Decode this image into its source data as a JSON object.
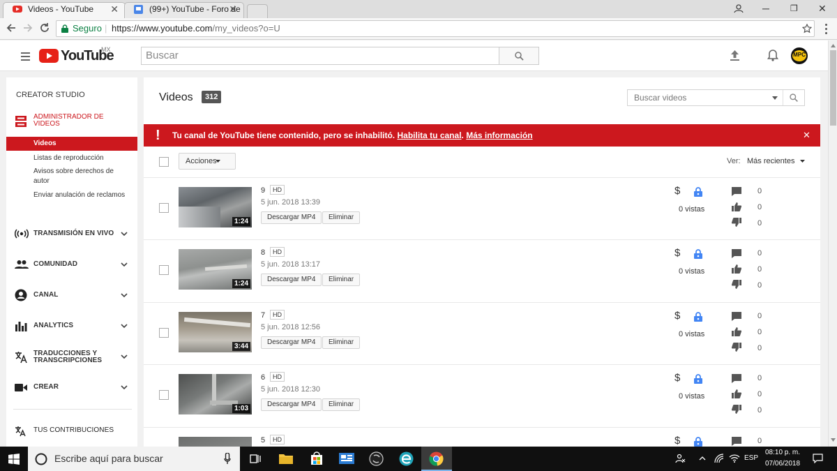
{
  "browser": {
    "tabs": [
      {
        "title": "Videos - YouTube"
      },
      {
        "title": "(99+) YouTube - Foro de"
      }
    ],
    "secure_label": "Seguro",
    "url_host": "https://www.youtube.com",
    "url_path": "/my_videos?o=U"
  },
  "masthead": {
    "logo_text": "YouTube",
    "region": "MX",
    "search_placeholder": "Buscar",
    "avatar_text": "MPC"
  },
  "sidebar": {
    "header": "CREATOR STUDIO",
    "manager_label": "ADMINISTRADOR DE VIDEOS",
    "sub_items": [
      {
        "label": "Videos"
      },
      {
        "label": "Listas de reproducción"
      },
      {
        "label": "Avisos sobre derechos de autor"
      },
      {
        "label": "Enviar anulación de reclamos"
      }
    ],
    "sections": [
      {
        "label": "TRANSMISIÓN EN VIVO"
      },
      {
        "label": "COMUNIDAD"
      },
      {
        "label": "CANAL"
      },
      {
        "label": "ANALYTICS"
      },
      {
        "label": "TRADUCCIONES Y TRANSCRIPCIONES"
      },
      {
        "label": "CREAR"
      }
    ],
    "contrib_label": "TUS CONTRIBUCIONES"
  },
  "main": {
    "title": "Videos",
    "count": "312",
    "search_placeholder": "Buscar videos",
    "banner_text": "Tu canal de YouTube tiene contenido, pero se inhabilitó.",
    "banner_link1": "Habilita tu canal",
    "banner_sep": ".",
    "banner_link2": "Más información",
    "actions_label": "Acciones",
    "view_label": "Ver:",
    "sort_label": "Más recientes",
    "download_label": "Descargar MP4",
    "delete_label": "Eliminar",
    "videos": [
      {
        "title": "9",
        "quality": "HD",
        "date": "5 jun. 2018 13:39",
        "duration": "1:24",
        "views": "0 vistas",
        "comments": "0",
        "likes": "0",
        "dislikes": "0"
      },
      {
        "title": "8",
        "quality": "HD",
        "date": "5 jun. 2018 13:17",
        "duration": "1:24",
        "views": "0 vistas",
        "comments": "0",
        "likes": "0",
        "dislikes": "0"
      },
      {
        "title": "7",
        "quality": "HD",
        "date": "5 jun. 2018 12:56",
        "duration": "3:44",
        "views": "0 vistas",
        "comments": "0",
        "likes": "0",
        "dislikes": "0"
      },
      {
        "title": "6",
        "quality": "HD",
        "date": "5 jun. 2018 12:30",
        "duration": "1:03",
        "views": "0 vistas",
        "comments": "0",
        "likes": "0",
        "dislikes": "0"
      },
      {
        "title": "5",
        "quality": "HD",
        "date": "",
        "duration": "",
        "views": "",
        "comments": "0",
        "likes": "",
        "dislikes": ""
      }
    ]
  },
  "taskbar": {
    "search_placeholder": "Escribe aquí para buscar",
    "lang": "ESP",
    "time": "08:10 p. m.",
    "date": "07/06/2018"
  }
}
